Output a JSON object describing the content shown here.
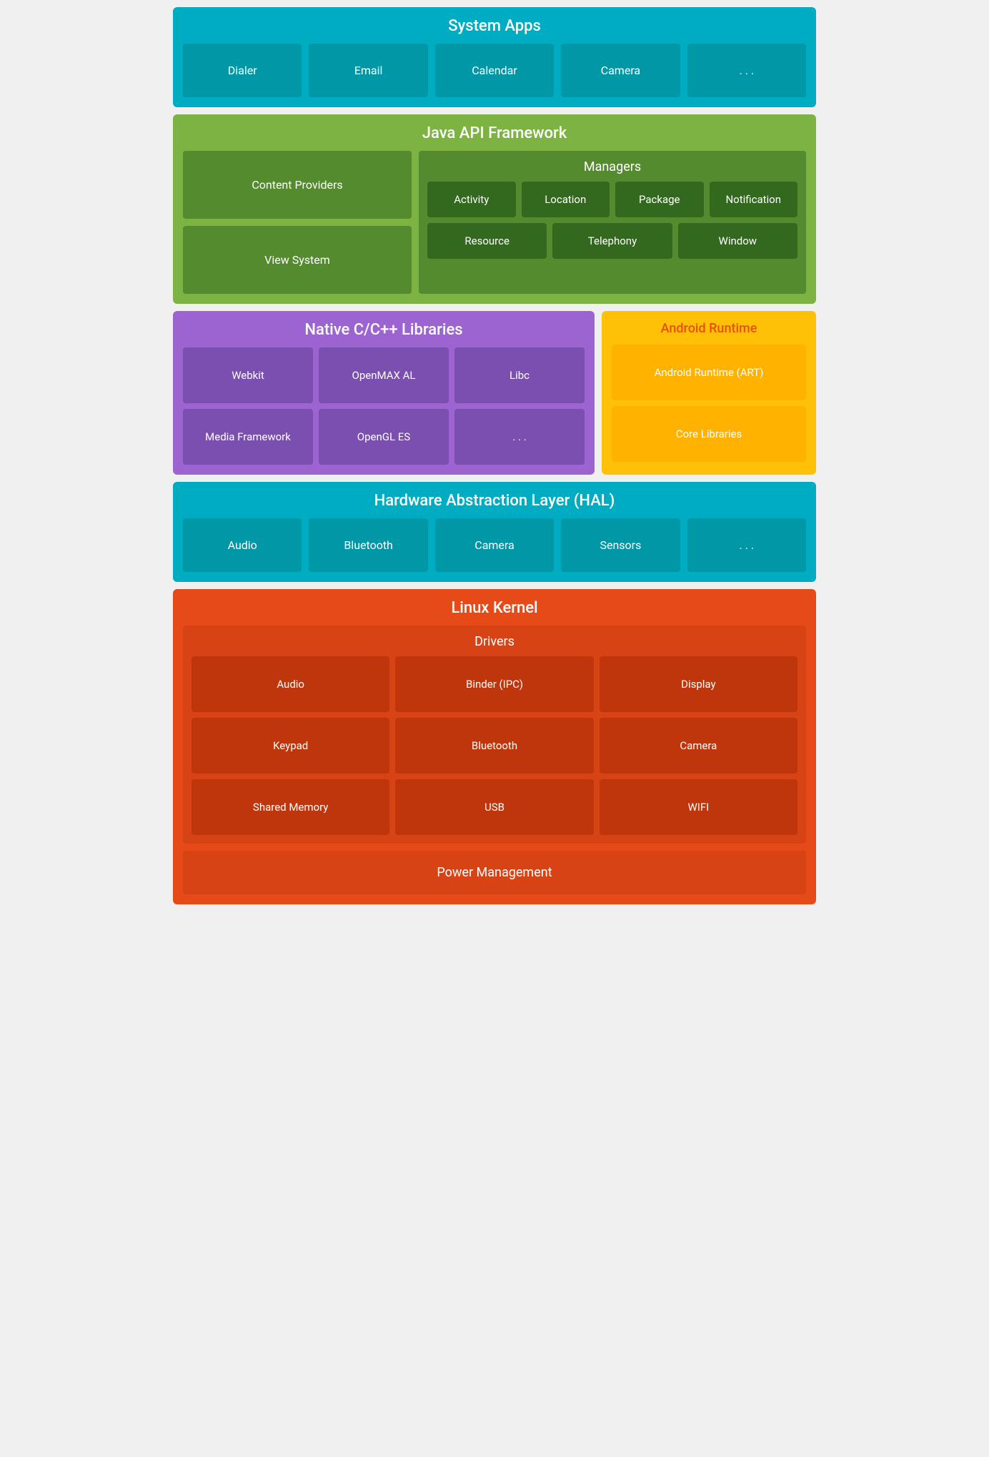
{
  "systemApps": {
    "title": "System Apps",
    "items": [
      "Dialer",
      "Email",
      "Calendar",
      "Camera",
      ". . ."
    ]
  },
  "javaApi": {
    "title": "Java API Framework",
    "left": [
      "Content Providers",
      "View System"
    ],
    "managers": {
      "title": "Managers",
      "row1": [
        "Activity",
        "Location",
        "Package",
        "Notification"
      ],
      "row2": [
        "Resource",
        "Telephony",
        "Window"
      ]
    }
  },
  "nativeCpp": {
    "title": "Native C/C++ Libraries",
    "row1": [
      "Webkit",
      "OpenMAX AL",
      "Libc"
    ],
    "row2": [
      "Media Framework",
      "OpenGL ES",
      ". . ."
    ]
  },
  "androidRuntime": {
    "title": "Android Runtime",
    "items": [
      "Android Runtime (ART)",
      "Core Libraries"
    ]
  },
  "hal": {
    "title": "Hardware Abstraction Layer (HAL)",
    "items": [
      "Audio",
      "Bluetooth",
      "Camera",
      "Sensors",
      ". . ."
    ]
  },
  "linuxKernel": {
    "title": "Linux Kernel",
    "drivers": {
      "title": "Drivers",
      "row1": [
        "Audio",
        "Binder (IPC)",
        "Display"
      ],
      "row2": [
        "Keypad",
        "Bluetooth",
        "Camera"
      ],
      "row3": [
        "Shared Memory",
        "USB",
        "WIFI"
      ]
    },
    "powerManagement": "Power Management"
  }
}
